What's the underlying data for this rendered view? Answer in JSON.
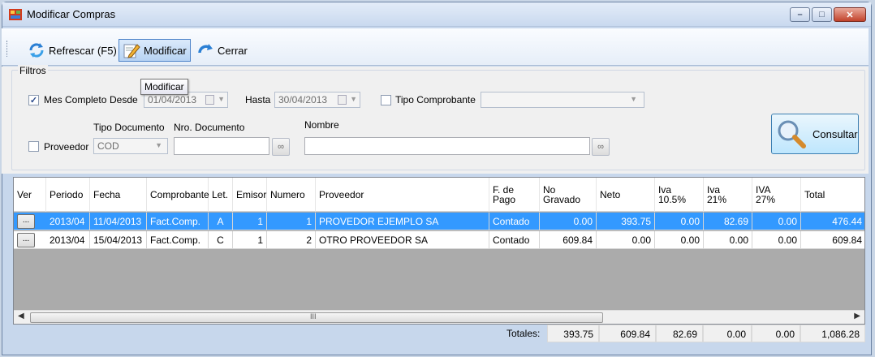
{
  "window": {
    "title": "Modificar Compras"
  },
  "toolbar": {
    "refresh_label": "Refrescar (F5)",
    "modify_label": "Modificar",
    "close_label": "Cerrar",
    "tooltip": "Modificar"
  },
  "filters": {
    "group_label": "Filtros",
    "mes_completo_label": "Mes Completo",
    "mes_completo_checked": true,
    "desde_label": "Desde",
    "desde_value": "01/04/2013",
    "hasta_label": "Hasta",
    "hasta_value": "30/04/2013",
    "tipo_comprobante_label": "Tipo Comprobante",
    "tipo_comprobante_value": "",
    "proveedor_label": "Proveedor",
    "tipo_documento_label": "Tipo Documento",
    "tipo_documento_value": "COD",
    "nro_documento_label": "Nro. Documento",
    "nro_documento_value": "",
    "nombre_label": "Nombre",
    "nombre_value": "",
    "consultar_label": "Consultar"
  },
  "grid": {
    "columns": {
      "ver": "Ver",
      "periodo": "Periodo",
      "fecha": "Fecha",
      "comprobante": "Comprobante",
      "let": "Let.",
      "emisor": "Emisor",
      "numero": "Numero",
      "proveedor": "Proveedor",
      "fpago_1": "F. de",
      "fpago_2": "Pago",
      "nograv_1": "No",
      "nograv_2": "Gravado",
      "neto": "Neto",
      "iva105_1": "Iva",
      "iva105_2": "10.5%",
      "iva21_1": "Iva",
      "iva21_2": "21%",
      "iva27_1": "IVA",
      "iva27_2": "27%",
      "total": "Total"
    },
    "rows": [
      {
        "ver": "...",
        "periodo": "2013/04",
        "fecha": "11/04/2013",
        "comprobante": "Fact.Comp.",
        "let": "A",
        "emisor": "1",
        "numero": "1",
        "proveedor": "PROVEDOR EJEMPLO SA",
        "fpago": "Contado",
        "nograv": "0.00",
        "neto": "393.75",
        "iva105": "0.00",
        "iva21": "82.69",
        "iva27": "0.00",
        "total": "476.44"
      },
      {
        "ver": "...",
        "periodo": "2013/04",
        "fecha": "15/04/2013",
        "comprobante": "Fact.Comp.",
        "let": "C",
        "emisor": "1",
        "numero": "2",
        "proveedor": "OTRO PROVEEDOR SA",
        "fpago": "Contado",
        "nograv": "609.84",
        "neto": "0.00",
        "iva105": "0.00",
        "iva21": "0.00",
        "iva27": "0.00",
        "total": "609.84"
      }
    ],
    "scroll_grip": "III"
  },
  "totals": {
    "label": "Totales:",
    "nograv": "393.75",
    "neto": "609.84",
    "iva105": "82.69",
    "iva21": "0.00",
    "iva27": "0.00",
    "total": "1,086.28"
  }
}
